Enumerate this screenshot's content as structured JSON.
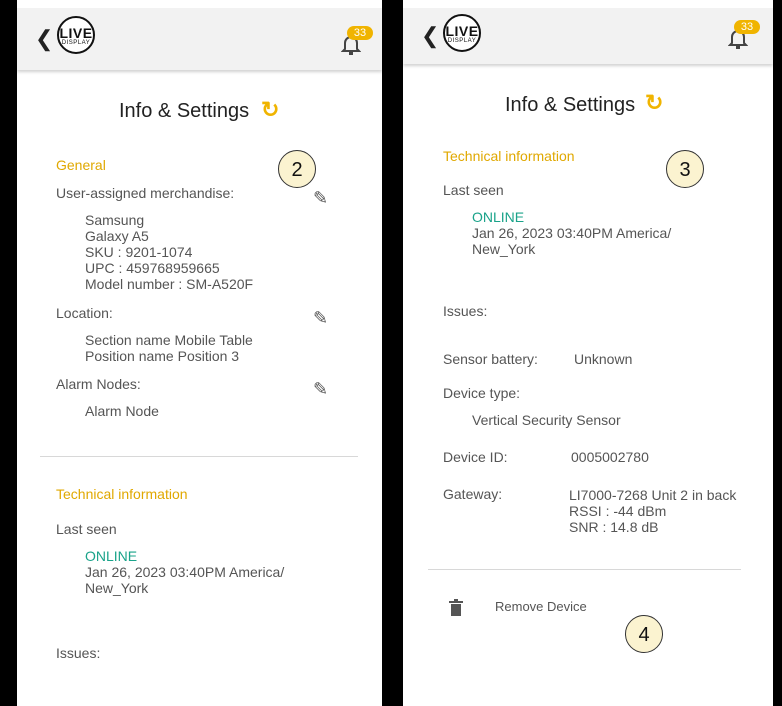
{
  "screens": {
    "left": {
      "header": {
        "back_label": "<",
        "logo_live": "LIVE",
        "logo_display": "DISPLAY",
        "notification_count": "33"
      },
      "title": "Info & Settings",
      "step_marker": "2",
      "general": {
        "heading": "General",
        "merch_label": "User-assigned merchandise:",
        "merch_lines": [
          "Samsung",
          "Galaxy A5",
          "SKU : 9201-1074",
          "UPC : 459768959665",
          "Model number : SM-A520F"
        ],
        "location_label": "Location:",
        "location_lines": [
          "Section name Mobile Table",
          "Position name Position 3"
        ],
        "alarm_label": "Alarm Nodes:",
        "alarm_value": "Alarm Node"
      },
      "tech": {
        "heading": "Technical information",
        "last_seen_label": "Last seen",
        "status": "ONLINE",
        "timestamp_line1": "Jan 26, 2023 03:40PM America/",
        "timestamp_line2": "New_York",
        "issues_label": "Issues:"
      }
    },
    "right": {
      "header": {
        "back_label": "<",
        "logo_live": "LIVE",
        "logo_display": "DISPLAY",
        "notification_count": "33"
      },
      "title": "Info & Settings",
      "step_marker": "3",
      "tech": {
        "heading": "Technical information",
        "last_seen_label": "Last seen",
        "status": "ONLINE",
        "timestamp_line1": "Jan 26, 2023 03:40PM America/",
        "timestamp_line2": "New_York",
        "issues_label": "Issues:",
        "battery_label": "Sensor battery:",
        "battery_value": "Unknown",
        "device_type_label": "Device type:",
        "device_type_value": "Vertical Security Sensor",
        "device_id_label": "Device ID:",
        "device_id_value": "0005002780",
        "gateway_label": "Gateway:",
        "gateway_lines": [
          "LI7000-7268 Unit 2 in back",
          "RSSI : -44 dBm",
          "SNR : 14.8 dB"
        ]
      },
      "remove_label": "Remove Device",
      "remove_marker": "4"
    }
  },
  "colors": {
    "accent": "#f0b400",
    "section": "#e0a800",
    "online": "#1aa38a",
    "marker_fill": "#fbf3d0"
  },
  "icons": [
    "chevron-left-icon",
    "bell-icon",
    "refresh-icon",
    "pencil-icon",
    "trash-icon"
  ]
}
